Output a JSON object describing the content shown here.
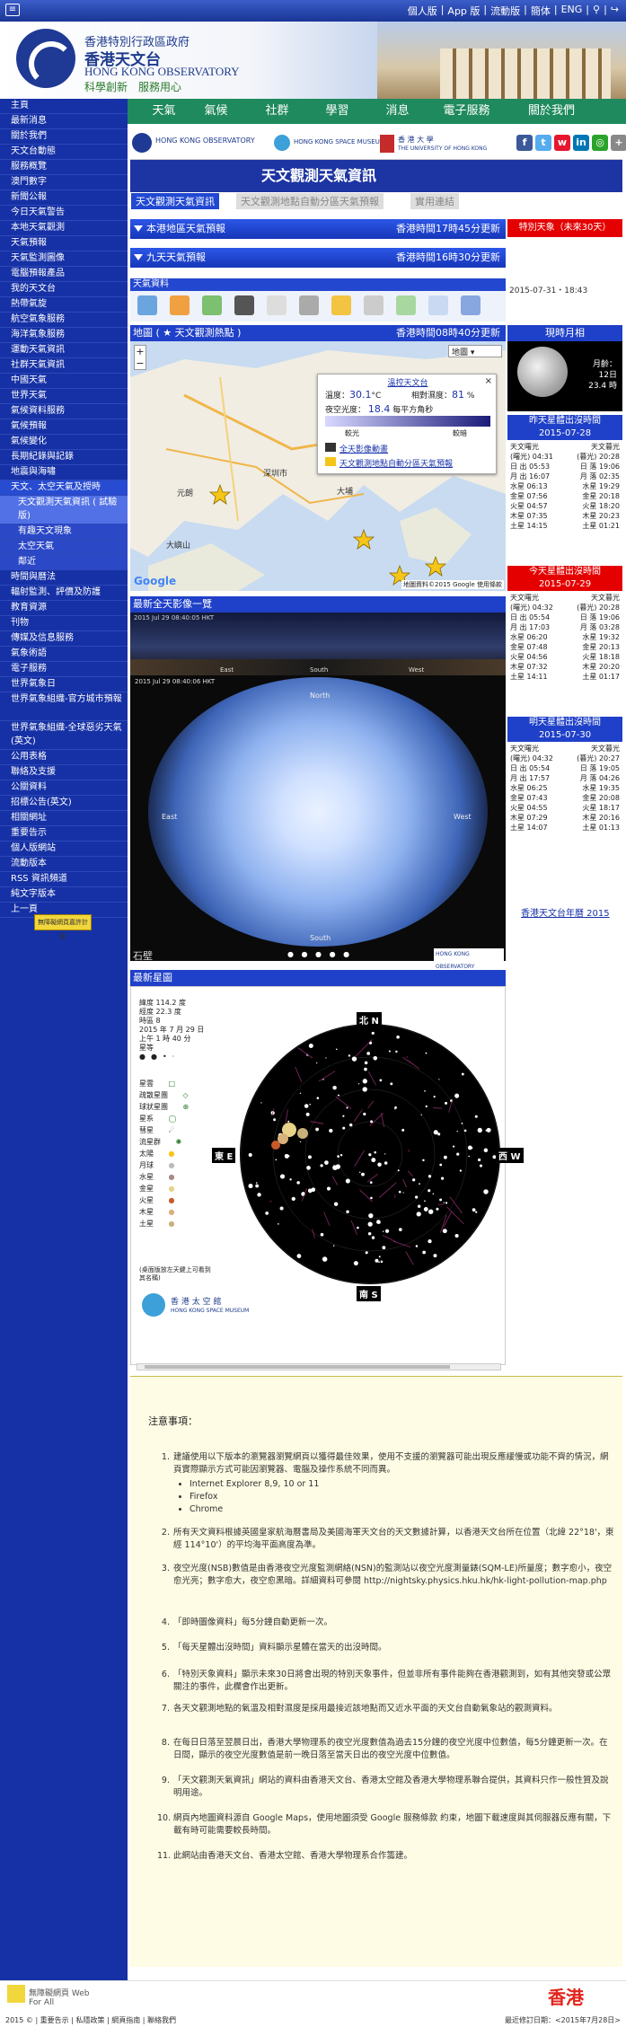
{
  "topbar": {
    "links": [
      "個人版",
      "App 版",
      "流動版",
      "簡体",
      "ENG"
    ]
  },
  "header": {
    "gov": "香港特別行政區政府",
    "org_zh": "香港天文台",
    "org_en": "HONG KONG OBSERVATORY",
    "motto": "科學創新　服務用心"
  },
  "nav": [
    "天氣",
    "氣候",
    "社群",
    "學習",
    "消息",
    "電子服務",
    "關於我們"
  ],
  "sidebar": [
    "主頁",
    "最新消息",
    "關於我們",
    "天文台動態",
    "服務概覽",
    "澳門數字",
    "新聞公報",
    "今日天氣警告",
    "本地天氣觀測",
    "天氣預報",
    "天氣監測圖像",
    "電腦預報產品",
    "我的天文台",
    "熱帶氣旋",
    "航空氣象服務",
    "海洋氣象服務",
    "運動天氣資訊",
    "社群天氣資訊",
    "中國天氣",
    "世界天氣",
    "氣候資料服務",
    "氣候預報",
    "氣候變化",
    "長期紀錄與記錄",
    "地震與海嘯",
    "天文、太空天氣及授時",
    "天文觀測天氣資訊 ( 試驗版)",
    "有趣天文現象",
    "太空天氣",
    "鄰近",
    "時間與曆法",
    "輻射監測、評價及防護",
    "教育資源",
    "刊物",
    "傳媒及信息服務",
    "氣象術語",
    "電子服務",
    "世界氣象日",
    "世界氣象組織-官方城市預報",
    "世界氣象組織-全球惡劣天氣(英文)",
    "公用表格",
    "聯絡及支援",
    "公關資料",
    "招標公告(英文)",
    "相關網址",
    "重要告示",
    "個人版網站",
    "流動版本",
    "RSS 資訊頻道",
    "純文字版本",
    "上一頁"
  ],
  "webforall": "無障礙網頁嘉許計劃",
  "partners": {
    "hko": "HONG KONG OBSERVATORY",
    "space": "HONG KONG SPACE MUSEUM",
    "hku": "香 港 大 學",
    "hku_en": "THE UNIVERSITY OF HONG KONG"
  },
  "page_title": "天文觀測天氣資訊",
  "tabs": [
    "天文觀測天氣資訊",
    "天文觀測地點自動分區天氣預報",
    "實用連結"
  ],
  "sections": {
    "local": {
      "title": "本港地區天氣預報",
      "time": "香港時間17時45分更新"
    },
    "nine": {
      "title": "九天天氣預報",
      "time": "香港時間16時30分更新"
    },
    "wx": "天氣資料",
    "map": {
      "title": "地圖 ( ★ 天文觀測熱點 )",
      "time": "香港時間08時40分更新"
    },
    "allsky": "最新全天影像一覽",
    "starmap": "最新星圖"
  },
  "special": {
    "title": "特別天象（未來30天）",
    "timestamp": "2015-07-31・18:43"
  },
  "map": {
    "dropdown": "地圖",
    "popup_title": "溫控天文台",
    "temp_label": "溫度：",
    "temp": "30.1",
    "temp_unit": "°C",
    "hum_label": "相對濕度：",
    "hum": "81",
    "hum_unit": "%",
    "sky_label": "夜空光度：",
    "sky_val": "18.4",
    "sky_unit": "每平方角秒",
    "bright": "較光",
    "dark": "較暗",
    "link1": "全天影像動畫",
    "link2": "天文觀測地點自動分區天氣預報",
    "google": "Google",
    "copyright": "地圖資料©2015 Google 使用條款",
    "places": [
      "元朗",
      "深圳市",
      "大埔",
      "大嶼山"
    ]
  },
  "moon": {
    "title": "現時月相",
    "day": "月齡：",
    "age": "12日",
    "hours": "23.4 時"
  },
  "rise": [
    {
      "title": "昨天星體出沒時間",
      "date": "2015-07-28",
      "rows": [
        [
          "天文曙光",
          "天文暮光"
        ],
        [
          "(曙光) 04:31",
          "(暮光) 20:28"
        ],
        [
          "日 出 05:53",
          "日 落 19:06"
        ],
        [
          "月 出 16:07",
          "月 落 02:35"
        ],
        [
          "水星 06:13",
          "水星 19:29"
        ],
        [
          "金星 07:56",
          "金星 20:18"
        ],
        [
          "火星 04:57",
          "火星 18:20"
        ],
        [
          "木星 07:35",
          "木星 20:23"
        ],
        [
          "土星 14:15",
          "土星 01:21"
        ]
      ]
    },
    {
      "title": "今天星體出沒時間",
      "date": "2015-07-29",
      "rows": [
        [
          "天文曙光",
          "天文暮光"
        ],
        [
          "(曙光) 04:32",
          "(暮光) 20:28"
        ],
        [
          "日 出 05:54",
          "日 落 19:06"
        ],
        [
          "月 出 17:03",
          "月 落 03:28"
        ],
        [
          "水星 06:20",
          "水星 19:32"
        ],
        [
          "金星 07:48",
          "金星 20:13"
        ],
        [
          "火星 04:56",
          "火星 18:18"
        ],
        [
          "木星 07:32",
          "木星 20:20"
        ],
        [
          "土星 14:11",
          "土星 01:17"
        ]
      ]
    },
    {
      "title": "明天星體出沒時間",
      "date": "2015-07-30",
      "rows": [
        [
          "天文曙光",
          "天文暮光"
        ],
        [
          "(曙光) 04:32",
          "(暮光) 20:27"
        ],
        [
          "日 出 05:54",
          "日 落 19:05"
        ],
        [
          "月 出 17:57",
          "月 落 04:26"
        ],
        [
          "水星 06:25",
          "水星 19:35"
        ],
        [
          "金星 07:43",
          "金星 20:08"
        ],
        [
          "火星 04:55",
          "火星 18:17"
        ],
        [
          "木星 07:29",
          "木星 20:16"
        ],
        [
          "土星 14:07",
          "土星 01:13"
        ]
      ]
    }
  ],
  "calendar_link": "香港天文台年曆 2015",
  "allsky": {
    "pan_time": "2015 Jul 29 08:40:05 HKT",
    "img_time": "2015 Jul 29 08:40:06 HKT",
    "north": "North",
    "south": "South",
    "east": "East",
    "west": "West",
    "loc": "石壁"
  },
  "starmap": {
    "info": [
      "緯度 114.2 度",
      "經度 22.3 度",
      "時區 8",
      "2015 年 7 月 29 日",
      "上午 1 時 40 分"
    ],
    "mag": "星等",
    "legend": [
      "星雲",
      "疏散星團",
      "球狀星團",
      "星系",
      "彗星",
      "流星群",
      "太陽",
      "月球",
      "水星",
      "金星",
      "火星",
      "木星",
      "土星"
    ],
    "note": "(桌面版放左天鍵上可看到其名稱)",
    "museum": "香 港 太 空 館",
    "museum_en": "HONG KONG SPACE MUSEUM",
    "n": "北 N",
    "s": "南 S",
    "e": "東 E",
    "w": "西 W"
  },
  "notes": {
    "title": "注意事項：",
    "items": [
      {
        "n": "1.",
        "t": "建議使用以下版本的瀏覽器瀏覽網頁以獲得最佳效果，使用不支援的瀏覽器可能出現反應緩慢或功能不齊的情況，網頁實際顯示方式可能因瀏覽器、電腦及操作系統不同而異。"
      },
      {
        "n": "2.",
        "t": "所有天文資料根據英國皇家航海曆書局及美國海軍天文台的天文數據計算，以香港天文台所在位置（北緯 22°18'，東經 114°10'）的平均海平面高度為準。"
      },
      {
        "n": "3.",
        "t": "夜空光度(NSB)數值是由香港夜空光度監測網絡(NSN)的監測站以夜空光度測量錶(SQM-LE)所量度；數字愈小，夜空愈光亮；數字愈大，夜空愈黑暗。詳細資料可參閱 http://nightsky.physics.hku.hk/hk-light-pollution-map.php"
      },
      {
        "n": "4.",
        "t": "「即時圖像資料」每5分鐘自動更新一次。"
      },
      {
        "n": "5.",
        "t": "「每天星體出沒時間」資料顯示星體在當天的出沒時間。"
      },
      {
        "n": "6.",
        "t": "「特別天象資料」顯示未來30日將會出現的特別天象事件，但並非所有事件能夠在香港觀測到，如有其他突發或公眾關注的事件，此欄會作出更新。"
      },
      {
        "n": "7.",
        "t": "各天文觀測地點的氣溫及相對濕度是採用最接近該地點而又近水平面的天文台自動氣象站的觀測資料。"
      },
      {
        "n": "8.",
        "t": "在每日日落至翌晨日出，香港大學物理系的夜空光度數值為過去15分鐘的夜空光度中位數值，每5分鐘更新一次。在日間，顯示的夜空光度數值是前一晚日落至當天日出的夜空光度中位數值。"
      },
      {
        "n": "9.",
        "t": "「天文觀測天氣資訊」網站的資料由香港天文台、香港太空館及香港大學物理系聯合提供，其資料只作一般性質及說明用途。"
      },
      {
        "n": "10.",
        "t": "網頁內地圖資料源自 Google Maps，使用地圖須受 Google 服務條款 約束，地圖下載速度與其伺服器反應有關，下載有時可能需要較長時間。"
      },
      {
        "n": "11.",
        "t": "此網站由香港天文台、香港太空館、香港大學物理系合作籌建。"
      }
    ]
  },
  "footer": {
    "left": "2015 © | 重要告示 | 私隱政策 | 網頁指南 | 聯絡我們",
    "right": "最近修訂日期：<2015年7月28日>",
    "brand": "香港",
    "webforall": "無障礙網頁 Web For All"
  }
}
